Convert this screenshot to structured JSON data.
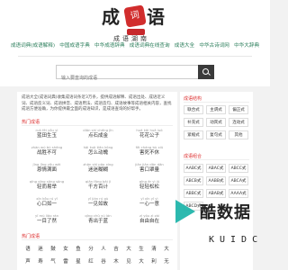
{
  "logo": {
    "big1": "成",
    "seal": "语",
    "big2": "语",
    "sub": "成语湖南"
  },
  "nav": [
    "成语词典(成语解释)",
    "中国成语字典",
    "中华成语辞典",
    "成语词典在线查询",
    "成语大全",
    "中华古诗词网",
    "中华大辞典"
  ],
  "search": {
    "placeholder": "输入要查询的成语"
  },
  "intro": "成语大全(成语词典)收集成语词条近3万条，提供成语解释、成语出处、成语近义词、成语反义词、成语拼音、成语用法、成语造句、成语故事等成语相关内容，查找成语方便准确，为你提供最全面的成语知识，是成语查询的好帮手。",
  "sections": {
    "hot": "热门成语",
    "pinyin": "热门成语",
    "side1": "成语结构",
    "side2": "成语组合"
  },
  "idioms": [
    {
      "py": "ruò fēi yǒu yì",
      "w": "蓝田生玉"
    },
    {
      "py": "diǎn shí chéng jīn",
      "w": "点石成金"
    },
    {
      "py": "huā kāi huā luò",
      "w": "花花公子"
    },
    {
      "py": "zhàn wú bù shèng",
      "w": "战胜不可"
    },
    {
      "py": "hǎi kuò tiān kōng",
      "w": "怎么动魄"
    },
    {
      "py": "fēi cháng bù xiǔ",
      "w": "害死不休"
    },
    {
      "py": "jīng jīng yǒu wèi",
      "w": "恩情满面"
    },
    {
      "py": "zhǎn shì pǎo xíng",
      "w": "迷迷糊糊"
    },
    {
      "py": "jiǎn jiǎn dān dān",
      "w": "害口罩量"
    },
    {
      "py": "qīng qīng sōng sōng",
      "w": "轻而易举"
    },
    {
      "py": "qiān fāng bǎi jì",
      "w": "千方百计"
    },
    {
      "py": "qīng ér yì jǔ",
      "w": "轻轻松松"
    },
    {
      "py": "xīn kǒu rú yī",
      "w": "心口如一"
    },
    {
      "py": "yī jiàn rú gù",
      "w": "一见如故"
    },
    {
      "py": "yī xīn yī yì",
      "w": "一心一意"
    },
    {
      "py": "yī mù liǎo rán",
      "w": "一目了然"
    },
    {
      "py": "qīng chū yú lán",
      "w": "青出于蓝"
    },
    {
      "py": "zì yóu zì zài",
      "w": "自由自在"
    }
  ],
  "chars": [
    [
      "语",
      "迷",
      "鼓",
      "女",
      "鱼",
      "分",
      "人",
      "吉",
      "大",
      "生",
      "清",
      "大"
    ],
    [
      "声",
      "寿",
      "气",
      "雷",
      "星",
      "红",
      "谷",
      "木",
      "见",
      "大",
      "利",
      "无"
    ]
  ],
  "structures": [
    "联合式",
    "主谓式",
    "偏正式",
    "补充式",
    "动宾式",
    "连动式",
    "紧缩式",
    "复句式",
    "其他"
  ],
  "combos": [
    "AABC式",
    "ABAC式",
    "ABCC式",
    "ABCB式",
    "AABB式",
    "ABCA式",
    "ABBC式",
    "ABAB式",
    "AAAA式",
    "ABCD式"
  ],
  "watermark": {
    "text": "酷数据",
    "sub": "KUIDC"
  }
}
